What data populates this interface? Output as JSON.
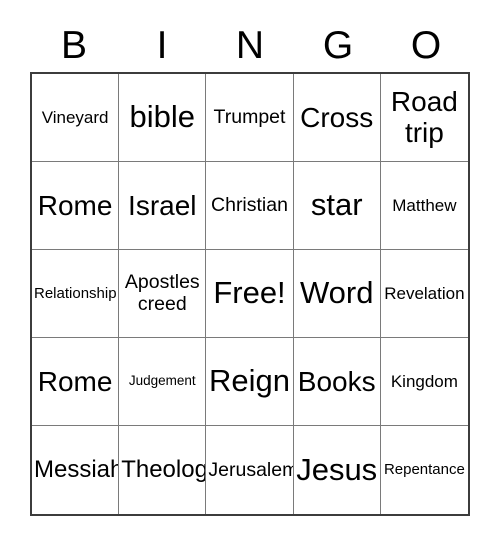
{
  "card": {
    "type": "bingo-card",
    "size": "5x5",
    "header_letters": [
      "B",
      "I",
      "N",
      "G",
      "O"
    ],
    "colors": {
      "background": "#ffffff",
      "text": "#000000",
      "outer_border": "#3c3c3c",
      "inner_border": "#7a7a7a"
    },
    "rows": [
      [
        {
          "text": "Vineyard",
          "size": "s"
        },
        {
          "text": "bible",
          "size": "xxl"
        },
        {
          "text": "Trumpet",
          "size": "m"
        },
        {
          "text": "Cross",
          "size": "xl"
        },
        {
          "text": "Road trip",
          "size": "xl",
          "lines": 2
        }
      ],
      [
        {
          "text": "Rome",
          "size": "xl"
        },
        {
          "text": "Israel",
          "size": "xl"
        },
        {
          "text": "Christian",
          "size": "m"
        },
        {
          "text": "star",
          "size": "xxl"
        },
        {
          "text": "Matthew",
          "size": "s"
        }
      ],
      [
        {
          "text": "Relationship",
          "size": "xs"
        },
        {
          "text": "Apostles creed",
          "size": "m",
          "lines": 2
        },
        {
          "text": "Free!",
          "size": "xxl"
        },
        {
          "text": "Word",
          "size": "xxl"
        },
        {
          "text": "Revelation",
          "size": "s"
        }
      ],
      [
        {
          "text": "Rome",
          "size": "xl"
        },
        {
          "text": "Judgement",
          "size": "xxs"
        },
        {
          "text": "Reign",
          "size": "xxl"
        },
        {
          "text": "Books",
          "size": "xl"
        },
        {
          "text": "Kingdom",
          "size": "s"
        }
      ],
      [
        {
          "text": "Messiah",
          "size": "l"
        },
        {
          "text": "Theology",
          "size": "l"
        },
        {
          "text": "Jerusalem",
          "size": "m"
        },
        {
          "text": "Jesus",
          "size": "xxl"
        },
        {
          "text": "Repentance",
          "size": "xs"
        }
      ]
    ]
  }
}
